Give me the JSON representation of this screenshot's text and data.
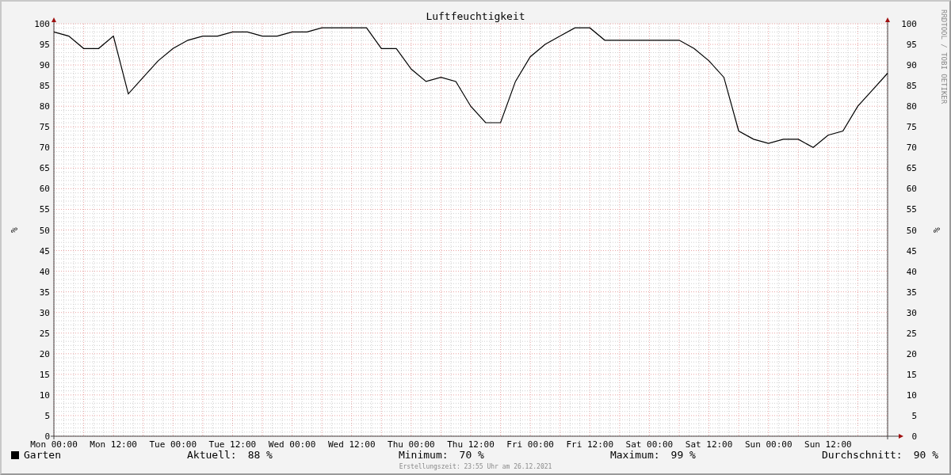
{
  "graph": {
    "credit": "RRDTOOL / TOBI OETIKER",
    "right_axis": {
      "label": "%",
      "ticks": [
        "100",
        "95",
        "90",
        "85",
        "80",
        "75",
        "70",
        "65",
        "60",
        "55",
        "50",
        "45",
        "40",
        "35",
        "30",
        "25",
        "20",
        "15",
        "10",
        "5",
        "0"
      ]
    },
    "chart_data": {
      "type": "line",
      "grid": true,
      "title": "Luftfeuchtigkeit",
      "ylabel": "%",
      "ylim": [
        0,
        100
      ],
      "categories": [
        "Mon 00:00",
        null,
        null,
        null,
        "Mon 12:00",
        null,
        null,
        null,
        "Tue 00:00",
        null,
        null,
        null,
        "Tue 12:00",
        null,
        null,
        null,
        "Wed 00:00",
        null,
        null,
        null,
        "Wed 12:00",
        null,
        null,
        null,
        "Thu 00:00",
        null,
        null,
        null,
        "Thu 12:00",
        null,
        null,
        null,
        "Fri 00:00",
        null,
        null,
        null,
        "Fri 12:00",
        null,
        null,
        null,
        "Sat 00:00",
        null,
        null,
        null,
        "Sat 12:00",
        null,
        null,
        null,
        "Sun 00:00",
        null,
        null,
        null,
        "Sun 12:00",
        null,
        null,
        null,
        null
      ],
      "yticks": [
        0,
        5,
        10,
        15,
        20,
        25,
        30,
        35,
        40,
        45,
        50,
        55,
        60,
        65,
        70,
        75,
        80,
        85,
        90,
        95,
        100
      ],
      "series": [
        {
          "name": "Garten",
          "color": "#000000",
          "values": [
            98,
            97,
            94,
            94,
            97,
            83,
            87,
            91,
            94,
            96,
            97,
            97,
            98,
            98,
            97,
            97,
            98,
            98,
            99,
            99,
            99,
            99,
            94,
            94,
            89,
            86,
            87,
            86,
            80,
            76,
            76,
            86,
            92,
            95,
            97,
            99,
            99,
            96,
            96,
            96,
            96,
            96,
            96,
            94,
            91,
            87,
            74,
            72,
            71,
            72,
            72,
            70,
            73,
            74,
            80,
            84,
            88
          ]
        }
      ]
    }
  },
  "stats": [
    {
      "label": "Aktuell:",
      "value": "88 %"
    },
    {
      "label": "Minimum:",
      "value": "70 %"
    },
    {
      "label": "Maximum:",
      "value": "99 %"
    },
    {
      "label": "Durchschnitt:",
      "value": "90 %"
    }
  ],
  "footer": "Erstellungszeit: 23:55 Uhr am 26.12.2021"
}
